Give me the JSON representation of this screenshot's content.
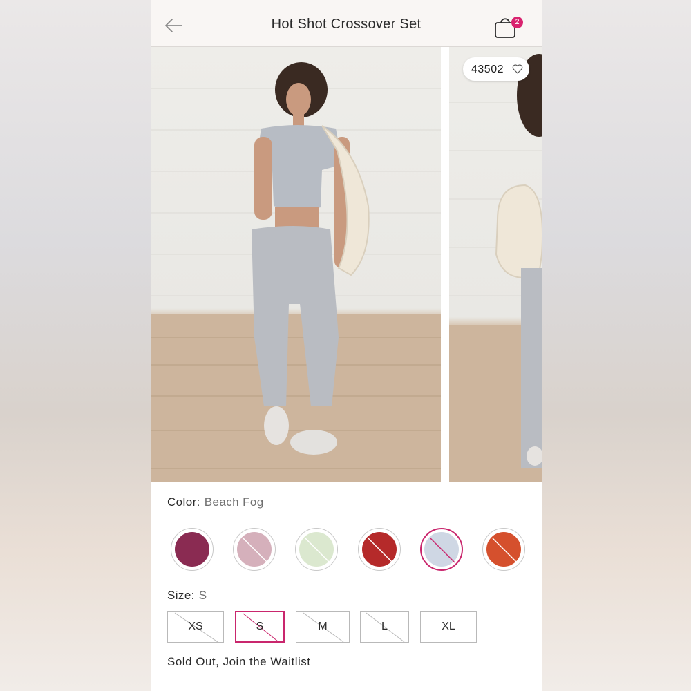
{
  "header": {
    "title": "Hot Shot Crossover Set",
    "cart_count": "2"
  },
  "gallery": {
    "favorites_count": "43502"
  },
  "color": {
    "label": "Color:",
    "selected": "Beach Fog",
    "swatches": [
      {
        "name": "plum",
        "color": "#8a2b52",
        "unavailable": false
      },
      {
        "name": "pink",
        "color": "#d5b0bb",
        "unavailable": true
      },
      {
        "name": "mint",
        "color": "#dbe8cf",
        "unavailable": true
      },
      {
        "name": "red",
        "color": "#b52a2a",
        "unavailable": true
      },
      {
        "name": "beach-fog",
        "color": "#cfd7e4",
        "unavailable": true
      },
      {
        "name": "orange",
        "color": "#d5502d",
        "unavailable": true
      }
    ]
  },
  "size": {
    "label": "Size:",
    "selected": "S",
    "options": [
      "XS",
      "S",
      "M",
      "L",
      "XL"
    ]
  },
  "waitlist_text": "Sold Out, Join the Waitlist",
  "colors": {
    "accent": "#c9266d",
    "badge": "#d9236f"
  }
}
